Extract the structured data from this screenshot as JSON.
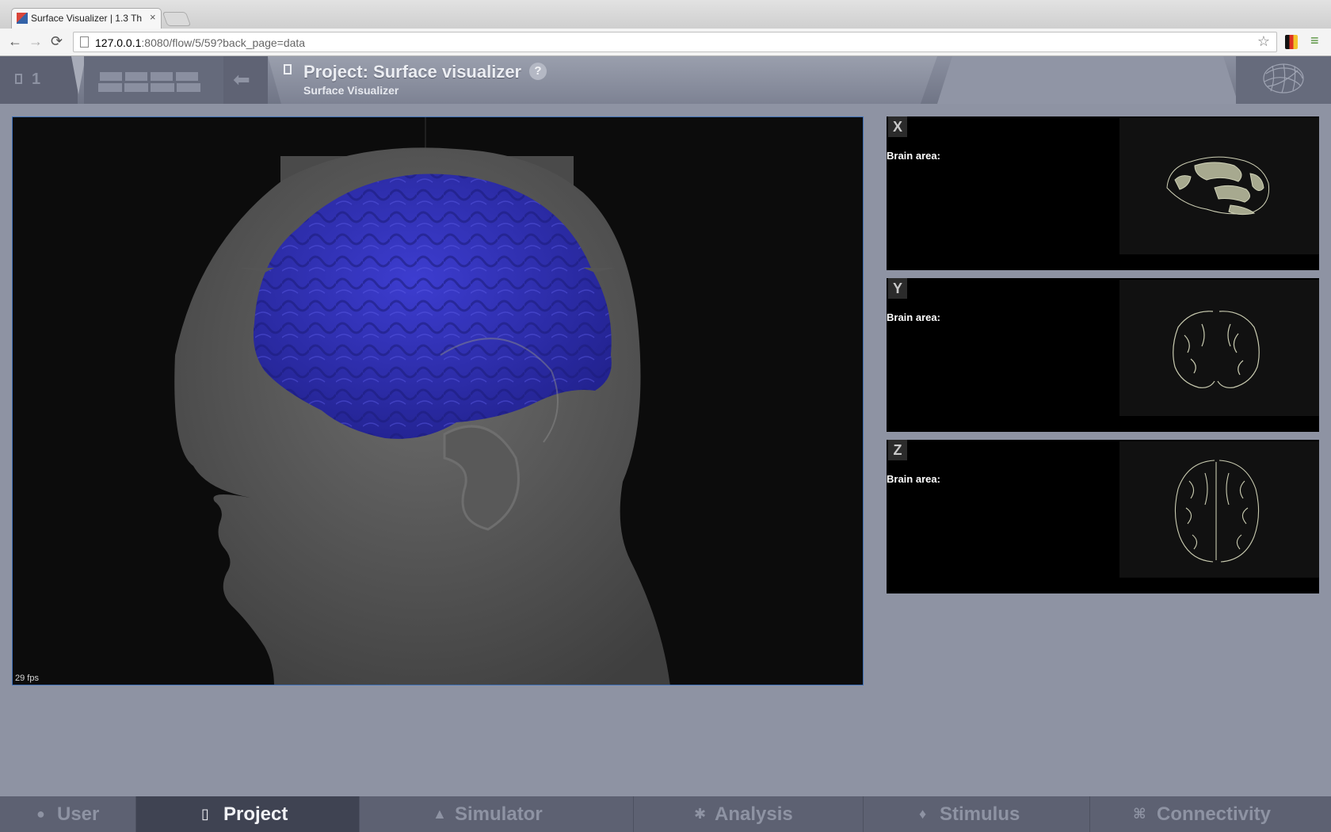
{
  "browser": {
    "tab_title": "Surface Visualizer | 1.3 Th",
    "tab_close": "×",
    "url_host": "127.0.0.1",
    "url_rest": ":8080/flow/5/59?back_page=data",
    "back": "←",
    "forward": "→",
    "reload": "⟳",
    "star": "☆",
    "menu": "≡"
  },
  "header": {
    "counter": "1",
    "back_arrow": "⬅",
    "title": "Project: Surface visualizer",
    "subtitle": "Surface Visualizer",
    "help": "?"
  },
  "canvas": {
    "fps": "29 fps",
    "brain_color": "#3535c0"
  },
  "slices": [
    {
      "axis": "X",
      "label": "Brain area:"
    },
    {
      "axis": "Y",
      "label": "Brain area:"
    },
    {
      "axis": "Z",
      "label": "Brain area:"
    }
  ],
  "bottom_nav": [
    {
      "label": "User",
      "icon": "user-icon",
      "active": false
    },
    {
      "label": "Project",
      "icon": "document-icon",
      "active": true
    },
    {
      "label": "Simulator",
      "icon": "rocket-icon",
      "active": false
    },
    {
      "label": "Analysis",
      "icon": "gear-icon",
      "active": false
    },
    {
      "label": "Stimulus",
      "icon": "pin-icon",
      "active": false
    },
    {
      "label": "Connectivity",
      "icon": "network-icon",
      "active": false
    }
  ]
}
